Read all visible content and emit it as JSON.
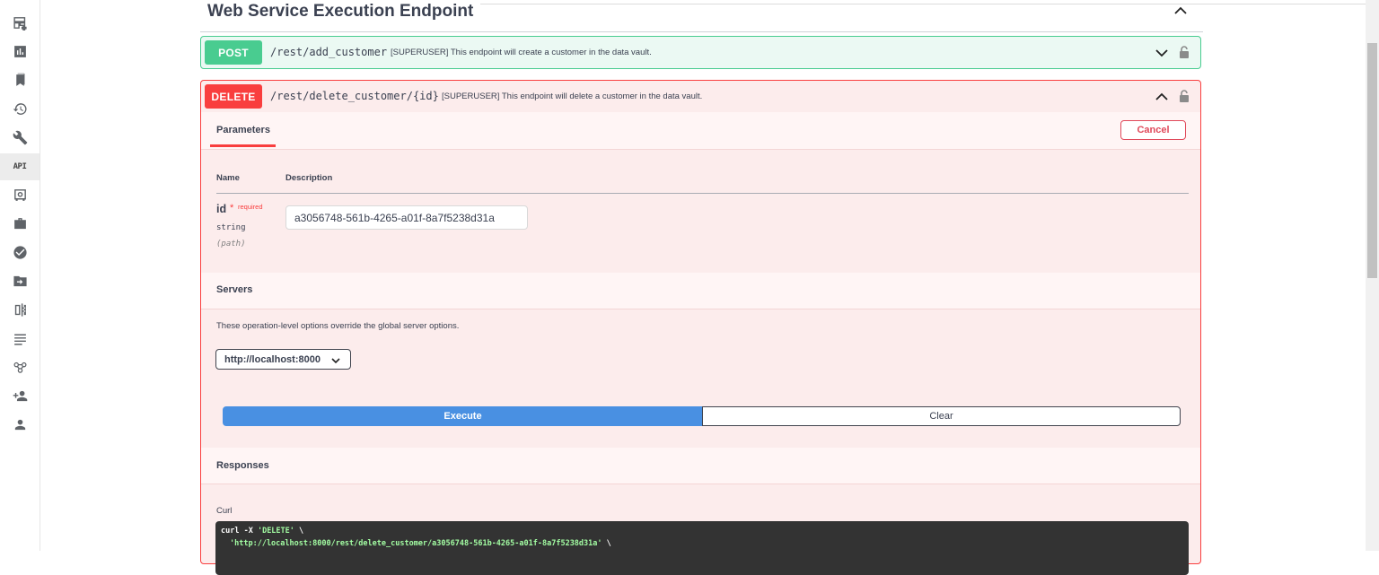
{
  "sidebar": {
    "icons": [
      "dashboard-add-icon",
      "bar-chart-icon",
      "bookmarks-icon",
      "history-icon",
      "wrench-icon",
      "api-icon",
      "safe-icon",
      "briefcase-icon",
      "check-circle-icon",
      "folder-move-icon",
      "document-compare-icon",
      "text-lines-icon",
      "flow-icon",
      "add-user-icon",
      "person-icon"
    ],
    "api_label": "API",
    "active": "api-icon"
  },
  "section": {
    "title": "Web Service Execution Endpoint"
  },
  "post_op": {
    "method": "POST",
    "path": "/rest/add_customer",
    "description": "[SUPERUSER] This endpoint will create a customer in the data vault."
  },
  "delete_op": {
    "method": "DELETE",
    "path": "/rest/delete_customer/{id}",
    "description": "[SUPERUSER] This endpoint will delete a customer in the data vault.",
    "tab_label": "Parameters",
    "cancel_label": "Cancel",
    "columns": {
      "name": "Name",
      "description": "Description"
    },
    "param": {
      "name": "id",
      "star": "*",
      "required": "required",
      "type": "string",
      "in": "(path)",
      "value": "a3056748-561b-4265-a01f-8a7f5238d31a"
    },
    "servers_title": "Servers",
    "servers_note": "These operation-level options override the global server options.",
    "server_selected": "http://localhost:8000",
    "execute_label": "Execute",
    "clear_label": "Clear",
    "responses_title": "Responses",
    "curl_label": "Curl",
    "curl_line1_cmd": "curl -X ",
    "curl_line1_str": "'DELETE'",
    "curl_line1_end": " \\",
    "curl_line2_str": "'http://localhost:8000/rest/delete_customer/a3056748-561b-4265-a01f-8a7f5238d31a'",
    "curl_line2_end": " \\"
  },
  "colors": {
    "post": "#49cc90",
    "delete": "#f93e3e",
    "execute": "#4990e2"
  }
}
